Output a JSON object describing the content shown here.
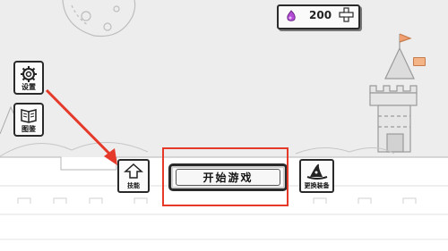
{
  "currency": {
    "amount": "200",
    "gem_icon": "purple-gem-icon",
    "plus_icon": "plus-icon"
  },
  "menu": {
    "settings_label": "设置",
    "codex_label": "图鉴",
    "skills_label": "技能",
    "start_label": "开始游戏",
    "equipment_label": "更换装备"
  },
  "colors": {
    "highlight": "#e53a2a",
    "gem": "#b44bd6",
    "ink": "#2a2a2a",
    "background": "#ededed"
  }
}
